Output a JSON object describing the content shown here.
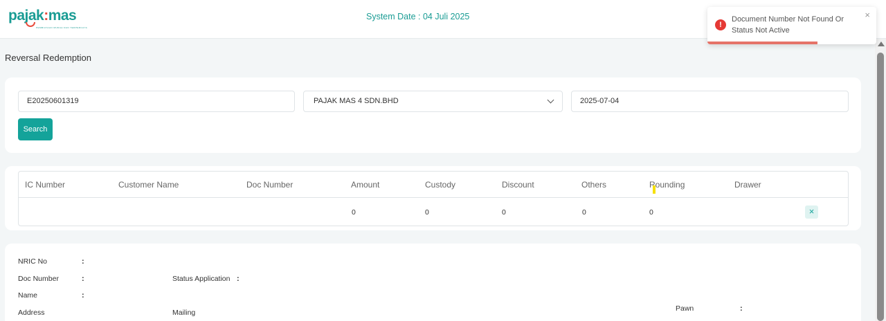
{
  "header": {
    "logo_main": "pajak",
    "logo_colon": ":",
    "logo_tail": "mas",
    "logo_tagline": "PEMBIAYAAN MUDAH DAN TERPERCAYA",
    "system_date": "System Date : 04 Juli 2025"
  },
  "page": {
    "title": "Reversal Redemption"
  },
  "search": {
    "doc_number": "E20250601319",
    "company": "PAJAK MAS 4 SDN.BHD",
    "date": "2025-07-04",
    "button_label": "Search"
  },
  "table": {
    "columns": [
      "IC Number",
      "Customer Name",
      "Doc Number",
      "Amount",
      "Custody",
      "Discount",
      "Others",
      "Rounding",
      "Drawer"
    ],
    "rows": [
      {
        "ic": "",
        "name": "",
        "doc": "",
        "amount": "0",
        "custody": "0",
        "discount": "0",
        "others": "0",
        "rounding": "0",
        "drawer": ""
      }
    ],
    "delete_icon": "×"
  },
  "details": {
    "nric_label": "NRIC No",
    "doc_label": "Doc Number",
    "status_label": "Status Application",
    "name_label": "Name",
    "address_label": "Address",
    "mailing_label": "Mailing",
    "pawn_label": "Pawn",
    "colon": ":"
  },
  "toast": {
    "type": "error",
    "icon": "!",
    "message": "Document Number Not Found Or Status Not Active",
    "close": "×",
    "progress": 0.65
  },
  "colors": {
    "accent": "#14a39a",
    "error": "#e53935",
    "background": "#f3f6f7"
  }
}
